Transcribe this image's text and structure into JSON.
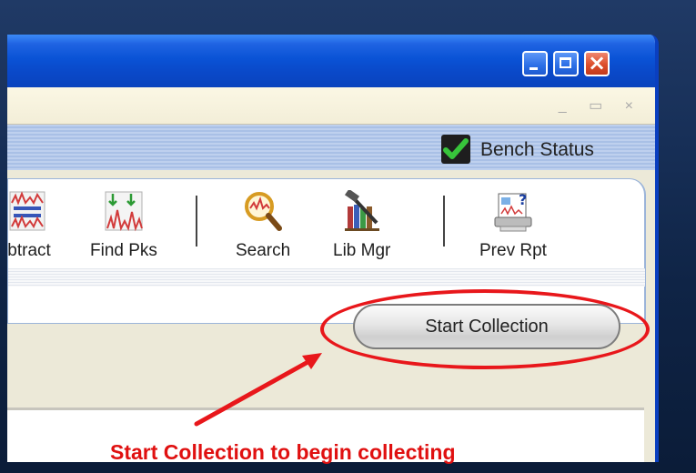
{
  "window": {
    "titlebar_buttons": [
      "minimize",
      "maximize",
      "close"
    ],
    "close_glyph": "×"
  },
  "mdi": {
    "icons_text": "_ ▭ ×"
  },
  "bench": {
    "status_label": "Bench Status",
    "status_icon": "checkmark-icon",
    "status_color": "#1a8f1f"
  },
  "toolbar": {
    "items": [
      {
        "label": "ıbtract",
        "icon": "subtract-spectra-icon"
      },
      {
        "label": "Find Pks",
        "icon": "find-peaks-icon"
      },
      {
        "label": "Search",
        "icon": "search-magnifier-icon"
      },
      {
        "label": "Lib Mgr",
        "icon": "library-manager-icon"
      },
      {
        "label": "Prev Rpt",
        "icon": "preview-report-icon"
      }
    ]
  },
  "actions": {
    "start_collection": "Start Collection"
  },
  "annotation": {
    "caption": "Start Collection to begin collecting",
    "color": "#e8171b"
  }
}
